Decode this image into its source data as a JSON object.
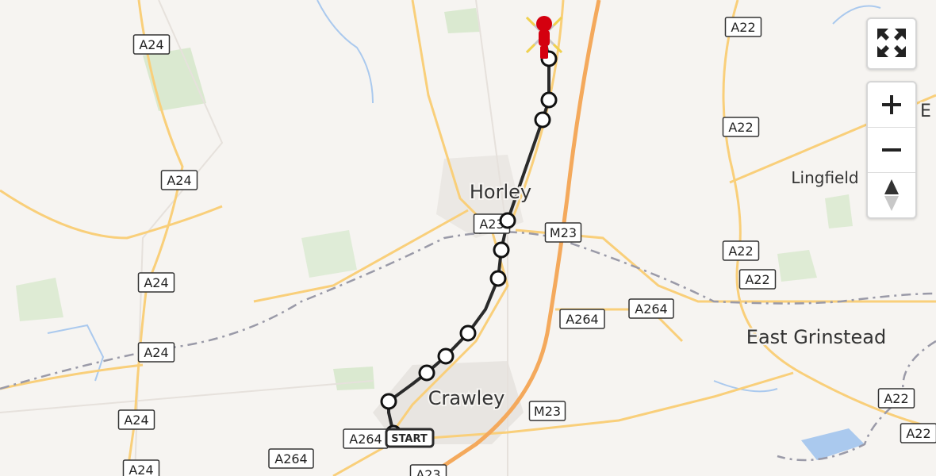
{
  "map": {
    "road_labels": [
      "A24",
      "A24",
      "A24",
      "A24",
      "A24",
      "A24",
      "A23",
      "M23",
      "M23",
      "A264",
      "A264",
      "A264",
      "A264",
      "A22",
      "A22",
      "A22",
      "A22",
      "A22",
      "A22",
      "A23"
    ],
    "place_labels": [
      "Horley",
      "Crawley",
      "East Grinstead",
      "Lingfield",
      "E"
    ],
    "route_markers": 11,
    "start_label": "START",
    "colors": {
      "background": "#f6f4f1",
      "motorway": "#f4a95c",
      "primary_road": "#f9cf7a",
      "urban_area": "#e8e5e1",
      "woodland": "#cfe4c2",
      "water": "#aac9ee",
      "route": "#2a2a2a",
      "boundary": "#9a9aa8",
      "destination": "#d4000f"
    }
  },
  "controls": {
    "fullscreen_icon": "fullscreen-icon",
    "zoom_in_icon": "plus-icon",
    "zoom_out_icon": "minus-icon",
    "compass_icon": "compass-icon"
  }
}
